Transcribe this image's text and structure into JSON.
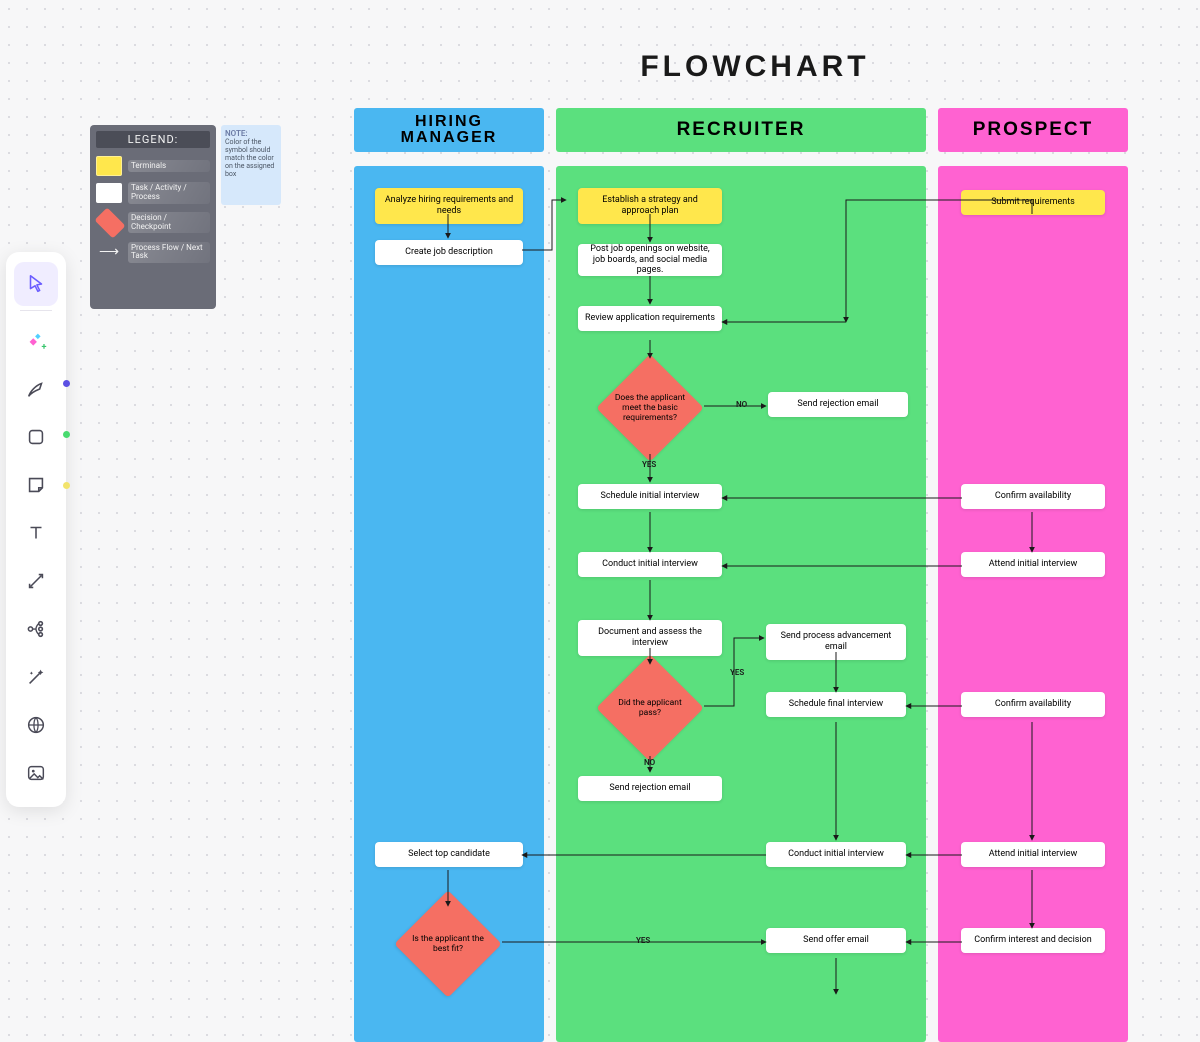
{
  "title": "FLOWCHART",
  "toolbar": {
    "tools": [
      "Select",
      "Magic",
      "Pen",
      "Shape",
      "Sticky",
      "Text",
      "Connector",
      "Mindmap",
      "Effects",
      "Web",
      "Image"
    ]
  },
  "indicator_dots": [
    "#5b50e3",
    "#48da6f",
    "#f2e36c"
  ],
  "legend": {
    "title": "LEGEND:",
    "rows": [
      {
        "kind": "terminal",
        "label": "Terminals"
      },
      {
        "kind": "task",
        "label": "Task / Activity / Process"
      },
      {
        "kind": "decision",
        "label": "Decision / Checkpoint"
      },
      {
        "kind": "flow",
        "label": "Process Flow / Next Task"
      }
    ]
  },
  "note": {
    "head": "NOTE:",
    "body": "Color of the symbol should match the color on the assigned box"
  },
  "lanes": {
    "hm": "HIRING\nMANAGER",
    "re": "RECRUITER",
    "pr": "PROSPECT"
  },
  "nodes": {
    "hm_analyze": "Analyze hiring requirements and needs",
    "hm_jd": "Create job description",
    "re_strategy": "Establish a strategy and approach plan",
    "re_post": "Post job openings on website, job boards, and social media pages.",
    "re_review": "Review application requirements",
    "re_dec_basic": "Does the applicant meet the basic requirements?",
    "re_reject1": "Send rejection email",
    "re_schedule_init": "Schedule initial interview",
    "re_conduct_init": "Conduct initial interview",
    "re_doc": "Document and assess the interview",
    "re_dec_pass": "Did the applicant pass?",
    "re_advance": "Send process advancement email",
    "re_schedule_final": "Schedule final interview",
    "re_reject2": "Send rejection email",
    "re_conduct_init2": "Conduct initial interview",
    "re_send_offer": "Send offer email",
    "pr_submit": "Submit requirements",
    "pr_confirm1": "Confirm availability",
    "pr_attend1": "Attend initial interview",
    "pr_confirm2": "Confirm availability",
    "pr_attend2": "Attend initial interview",
    "pr_decision": "Confirm interest and decision",
    "hm_select": "Select top candidate",
    "hm_dec_best": "Is the applicant the best fit?"
  },
  "edge_labels": {
    "yes": "YES",
    "no": "NO"
  }
}
